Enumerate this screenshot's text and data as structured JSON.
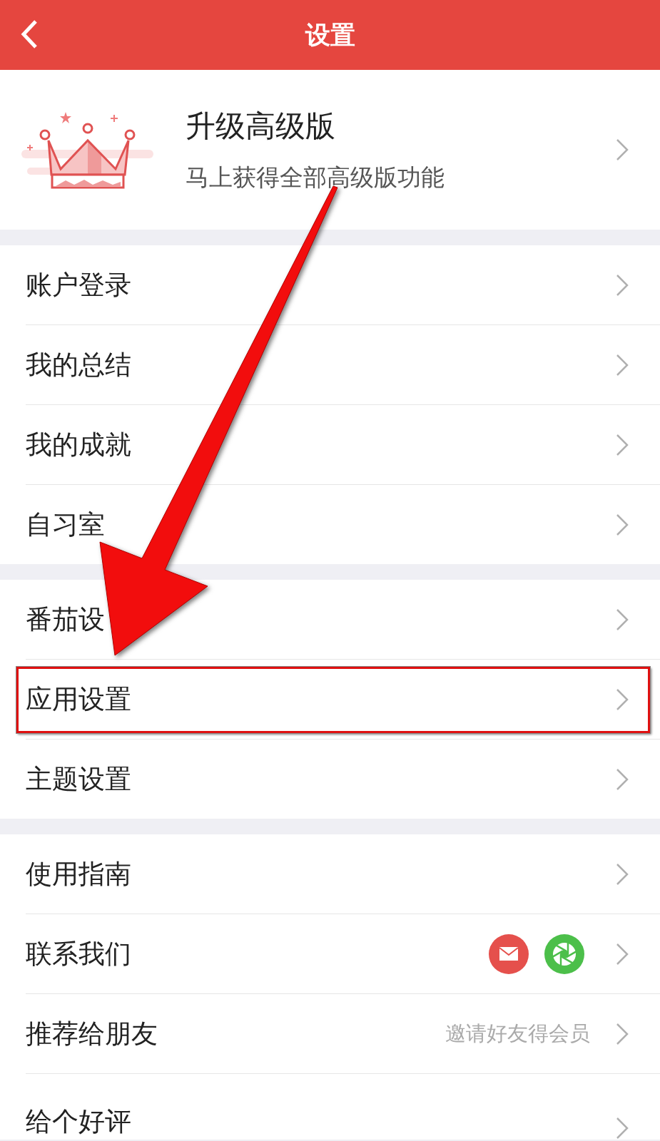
{
  "header": {
    "title": "设置"
  },
  "premium": {
    "title": "升级高级版",
    "subtitle": "马上获得全部高级版功能"
  },
  "sections": [
    [
      {
        "label": "账户登录",
        "kind": "plain"
      },
      {
        "label": "我的总结",
        "kind": "plain"
      },
      {
        "label": "我的成就",
        "kind": "plain"
      },
      {
        "label": "自习室",
        "kind": "plain"
      }
    ],
    [
      {
        "label": "番茄设",
        "kind": "plain"
      },
      {
        "label": "应用设置",
        "kind": "plain",
        "highlighted": true
      },
      {
        "label": "主题设置",
        "kind": "plain"
      }
    ],
    [
      {
        "label": "使用指南",
        "kind": "plain"
      },
      {
        "label": "联系我们",
        "kind": "contacts"
      },
      {
        "label": "推荐给朋友",
        "kind": "hint",
        "hint": "邀请好友得会员"
      },
      {
        "label": "给个好评",
        "kind": "plain"
      }
    ]
  ]
}
